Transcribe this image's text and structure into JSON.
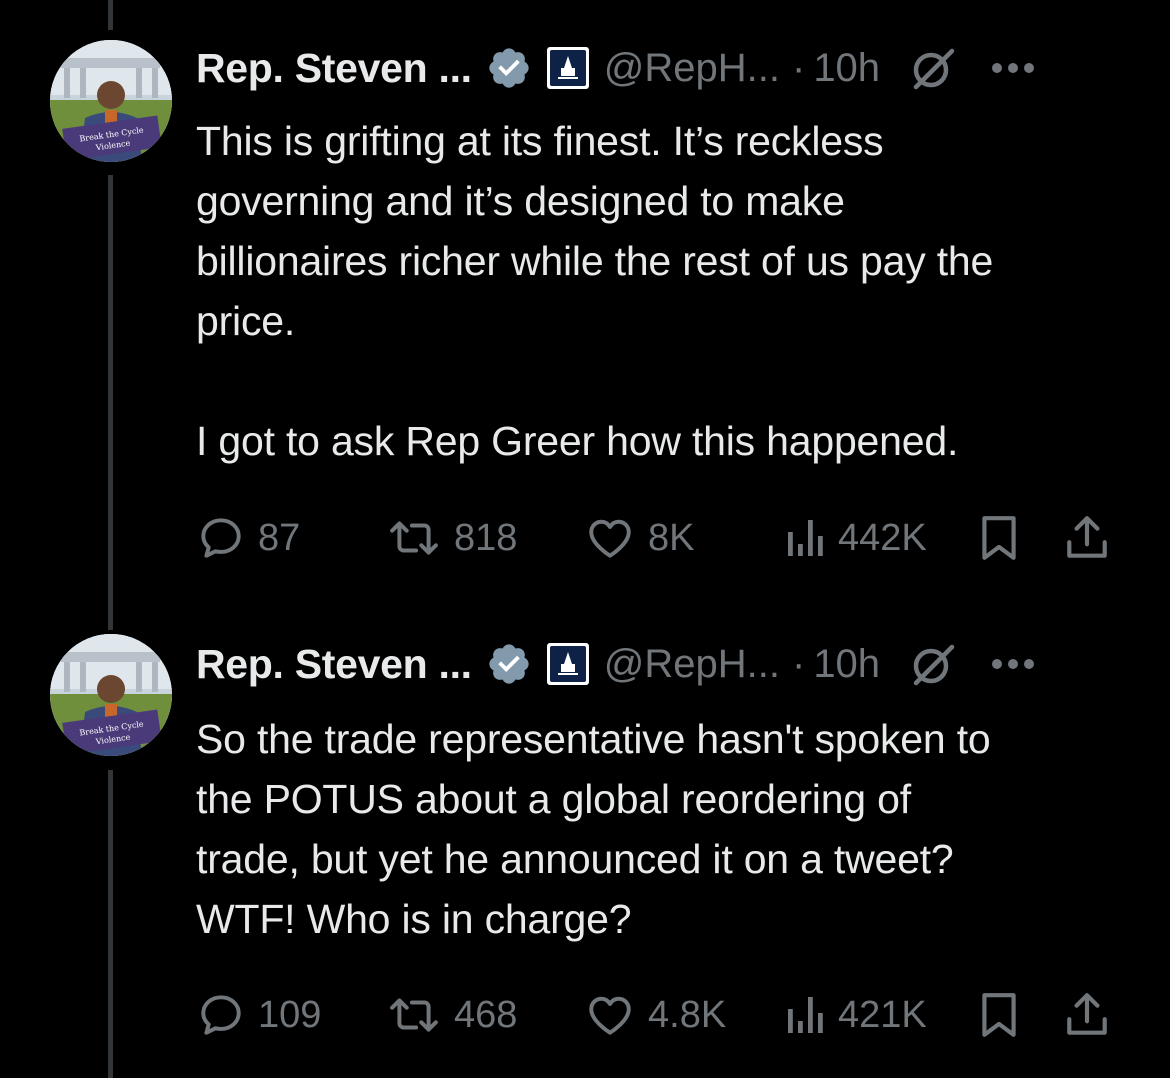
{
  "tweets": [
    {
      "display_name": "Rep. Steven ...",
      "handle": "@RepH...",
      "separator": "·",
      "time": "10h",
      "avatar_caption_line1": "Break the Cycle",
      "avatar_caption_line2": "Violence",
      "text": "This is grifting at its finest. It’s reckless\ngoverning and it’s designed to make\nbillionaires richer while the rest of us pay the\nprice.\n\nI got to ask Rep Greer how this happened.",
      "replies": "87",
      "reposts": "818",
      "likes": "8K",
      "views": "442K"
    },
    {
      "display_name": "Rep. Steven ...",
      "handle": "@RepH...",
      "separator": "·",
      "time": "10h",
      "avatar_caption_line1": "Break the Cycle",
      "avatar_caption_line2": "Violence",
      "text": "So the trade representative hasn't spoken to\nthe POTUS about a global reordering of\ntrade, but yet he announced it on a tweet?\nWTF! Who is in charge?",
      "replies": "109",
      "reposts": "468",
      "likes": "4.8K",
      "views": "421K"
    }
  ],
  "icons": {
    "verified": "verified-badge-icon",
    "affiliation": "capitol-affiliation-icon",
    "grok": "grok-icon",
    "more": "more-options-icon",
    "reply": "reply-icon",
    "repost": "repost-icon",
    "like": "heart-icon",
    "views": "views-bar-chart-icon",
    "bookmark": "bookmark-icon",
    "share": "share-icon"
  },
  "colors": {
    "background": "#000000",
    "text_primary": "#e7e9ea",
    "text_secondary": "#71767b",
    "thread_line": "#333639",
    "verified_badge": "#829aab"
  }
}
